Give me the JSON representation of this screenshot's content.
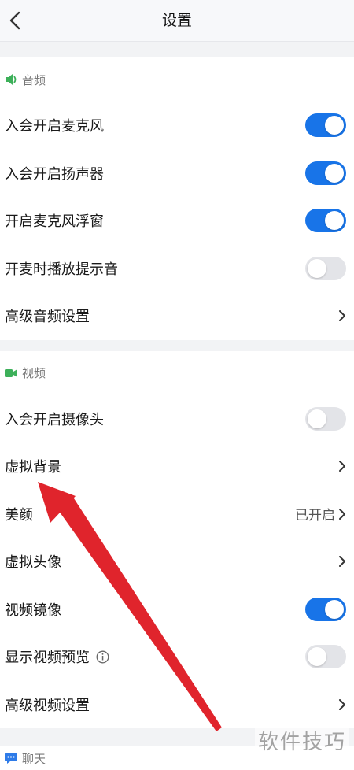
{
  "header": {
    "title": "设置"
  },
  "audio": {
    "header": "音频",
    "rows": [
      {
        "label": "入会开启麦克风",
        "control": "toggle",
        "on": true
      },
      {
        "label": "入会开启扬声器",
        "control": "toggle",
        "on": true
      },
      {
        "label": "开启麦克风浮窗",
        "control": "toggle",
        "on": true
      },
      {
        "label": "开麦时播放提示音",
        "control": "toggle",
        "on": false
      },
      {
        "label": "高级音频设置",
        "control": "chevron"
      }
    ]
  },
  "video": {
    "header": "视频",
    "rows": [
      {
        "label": "入会开启摄像头",
        "control": "toggle",
        "on": false
      },
      {
        "label": "虚拟背景",
        "control": "chevron"
      },
      {
        "label": "美颜",
        "control": "chevron",
        "value": "已开启"
      },
      {
        "label": "虚拟头像",
        "control": "chevron"
      },
      {
        "label": "视频镜像",
        "control": "toggle",
        "on": true
      },
      {
        "label": "显示视频预览",
        "control": "toggle",
        "on": false,
        "info_icon": "info-icon"
      },
      {
        "label": "高级视频设置",
        "control": "chevron"
      }
    ]
  },
  "chat": {
    "header": "聊天"
  },
  "watermark": "软件技巧",
  "colors": {
    "toggle_on": "#1874e8",
    "toggle_off": "#e3e4e8",
    "audio_icon": "#3db05a",
    "video_icon": "#3db05a",
    "chat_icon": "#2e7be8",
    "annotation_arrow": "#e0242c"
  }
}
